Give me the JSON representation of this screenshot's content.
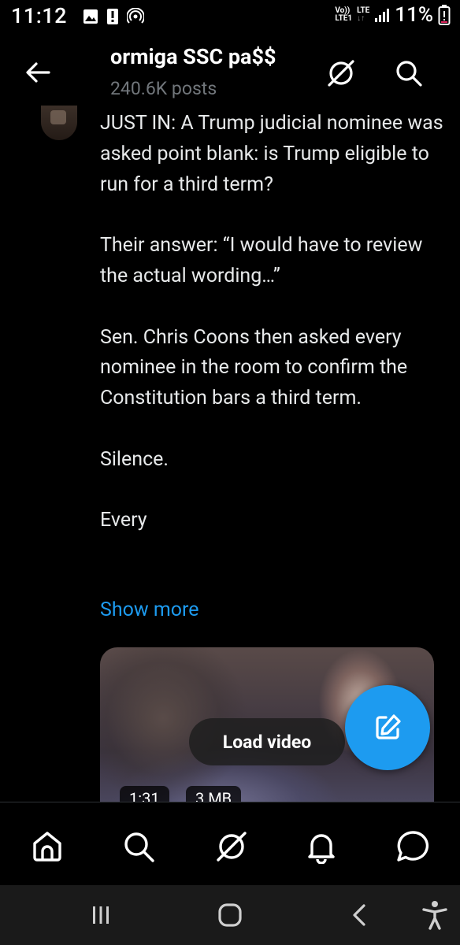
{
  "status_bar": {
    "time": "11:12",
    "carrier_line1": "Vo))",
    "carrier_line2": "LTE1",
    "lte_line1": "LTE",
    "lte_line2": "↓↑",
    "battery": "11%"
  },
  "header": {
    "title": "ormiga SSC pa$$",
    "subtitle": "240.6K posts"
  },
  "post": {
    "text": "JUST IN: A Trump judicial nominee was asked point blank: is Trump eligible to run for a third term?\n\nTheir answer: “I would have to review the actual wording…”\n\nSen. Chris Coons then asked every nominee in the room to confirm the Constitution bars a third term.\n\nSilence.\n\nEvery",
    "show_more": "Show more"
  },
  "video": {
    "load_label": "Load video",
    "duration": "1:31",
    "size": "3 MB"
  },
  "icons": {
    "back": "arrow-left-icon",
    "grok": "grok-icon",
    "search": "search-icon",
    "compose": "compose-icon",
    "home": "home-icon",
    "nav_search": "search-icon",
    "nav_grok": "grok-icon",
    "notifications": "bell-icon",
    "messages": "chat-bubble-icon"
  },
  "colors": {
    "accent": "#1d9bf0",
    "background": "#000000",
    "secondary_text": "#71767b"
  }
}
